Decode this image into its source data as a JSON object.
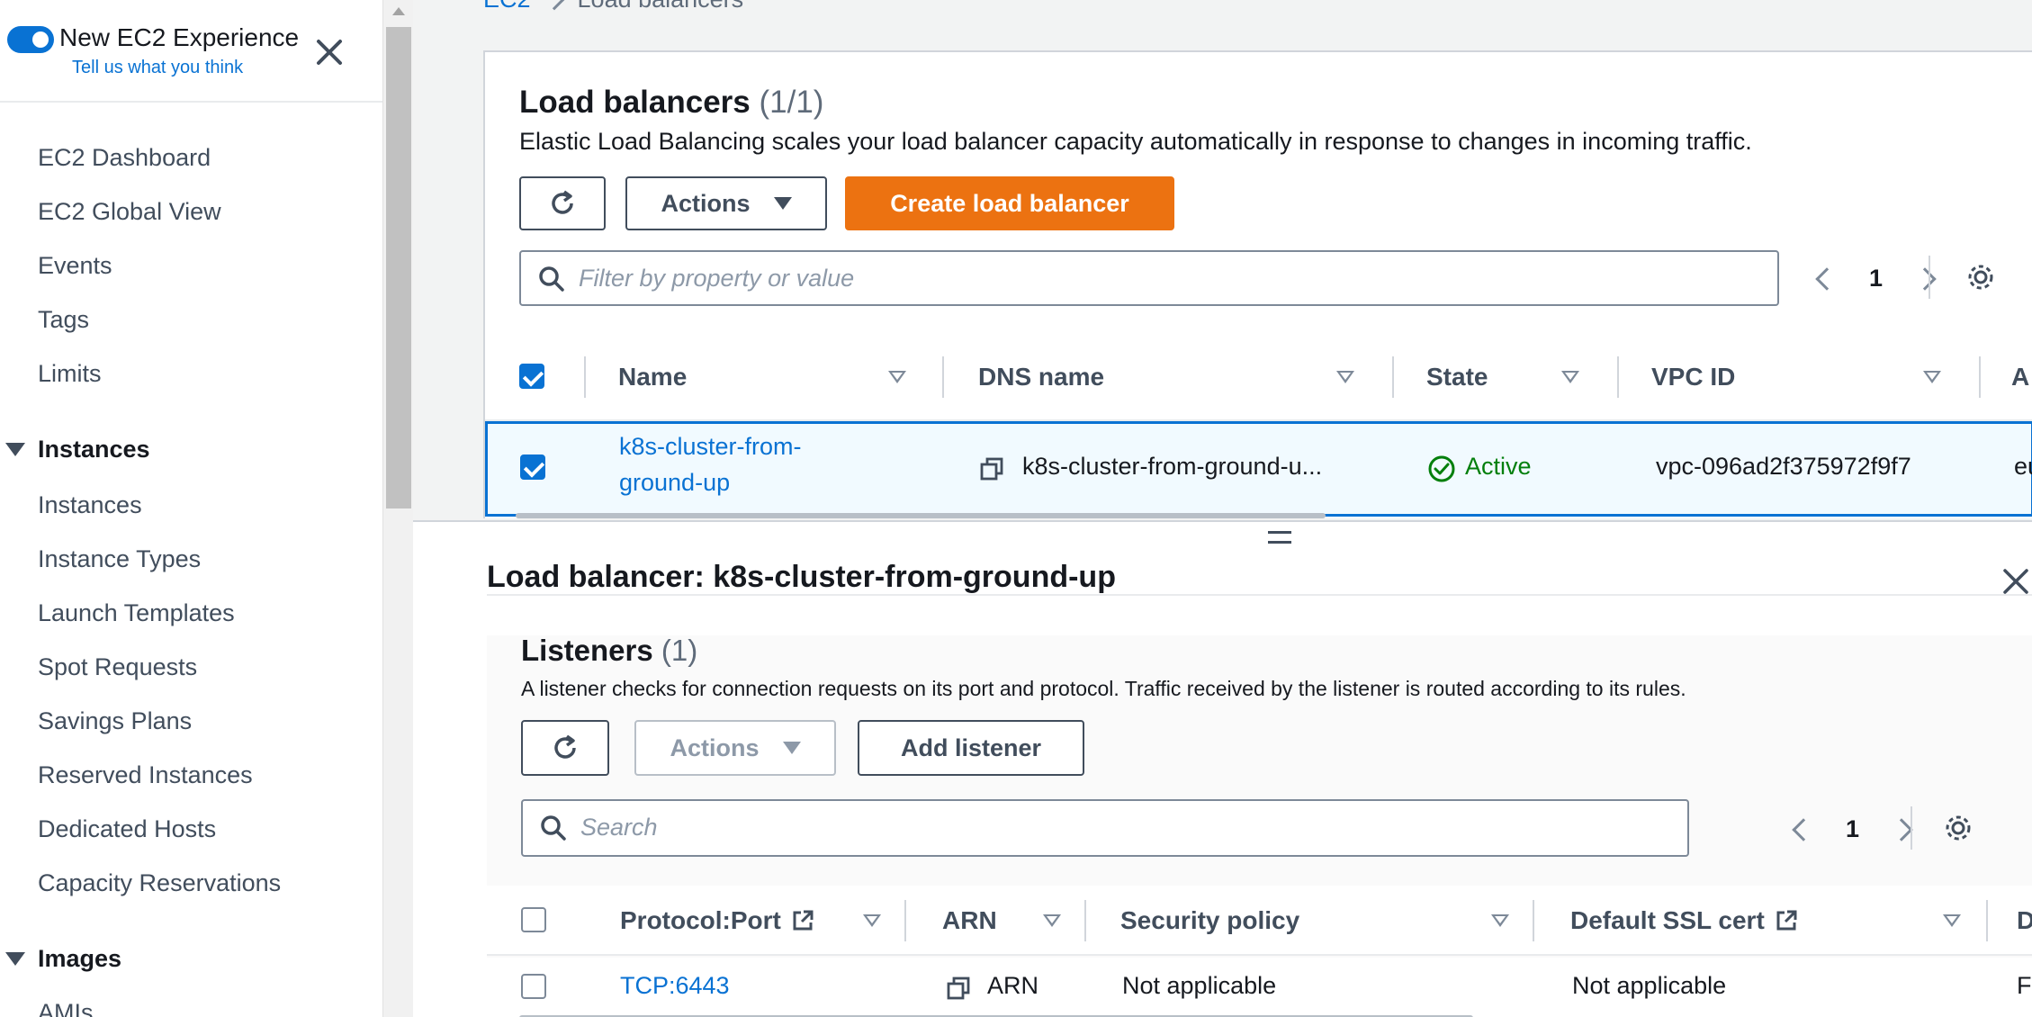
{
  "sidebar": {
    "toggle_label": "New EC2 Experience",
    "feedback_link": "Tell us what you think",
    "top_items": [
      "EC2 Dashboard",
      "EC2 Global View",
      "Events",
      "Tags",
      "Limits"
    ],
    "sections": [
      {
        "label": "Instances",
        "items": [
          "Instances",
          "Instance Types",
          "Launch Templates",
          "Spot Requests",
          "Savings Plans",
          "Reserved Instances",
          "Dedicated Hosts",
          "Capacity Reservations"
        ]
      },
      {
        "label": "Images",
        "items": [
          "AMIs"
        ]
      }
    ]
  },
  "breadcrumb": {
    "parent": "EC2",
    "current": "Load balancers"
  },
  "load_balancers": {
    "title": "Load balancers",
    "count": "(1/1)",
    "description": "Elastic Load Balancing scales your load balancer capacity automatically in response to changes in incoming traffic.",
    "actions_label": "Actions",
    "create_label": "Create load balancer",
    "filter_placeholder": "Filter by property or value",
    "page": "1",
    "columns": [
      "Name",
      "DNS name",
      "State",
      "VPC ID",
      "A"
    ],
    "row": {
      "name_line1": "k8s-cluster-from-",
      "name_line2": "ground-up",
      "dns": "k8s-cluster-from-ground-u...",
      "state": "Active",
      "vpc": "vpc-096ad2f375972f9f7",
      "az": "eu"
    }
  },
  "detail": {
    "title": "Load balancer: k8s-cluster-from-ground-up",
    "listeners": {
      "title": "Listeners",
      "count": "(1)",
      "description": "A listener checks for connection requests on its port and protocol. Traffic received by the listener is routed according to its rules.",
      "actions_label": "Actions",
      "add_label": "Add listener",
      "search_placeholder": "Search",
      "page": "1",
      "columns": [
        "Protocol:Port",
        "ARN",
        "Security policy",
        "Default SSL cert",
        "D"
      ],
      "row": {
        "protocol_port": "TCP:6443",
        "arn": "ARN",
        "security_policy": "Not applicable",
        "ssl_cert": "Not applicable",
        "default_action": "F"
      }
    }
  },
  "colors": {
    "accent": "#0972d3",
    "primary_button": "#ec7211",
    "success": "#037f0c"
  }
}
